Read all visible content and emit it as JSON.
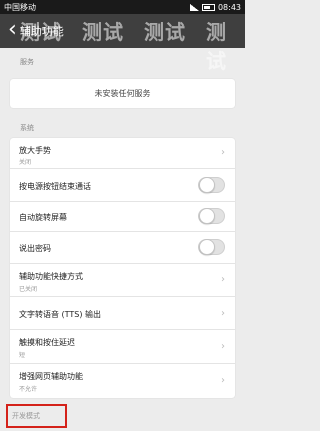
{
  "statusbar": {
    "carrier": "中国移动",
    "time": "08:43"
  },
  "titlebar": {
    "title": "辅助功能"
  },
  "watermark": [
    "测试",
    "测试",
    "测试",
    "测试",
    "测试"
  ],
  "services": {
    "section_label": "服务",
    "empty_text": "未安装任何服务"
  },
  "system": {
    "section_label": "系统",
    "items": [
      {
        "label": "放大手势",
        "sub": "关闭",
        "control": "chevron"
      },
      {
        "label": "按电源按钮结束通话",
        "control": "toggle"
      },
      {
        "label": "自动旋转屏幕",
        "control": "toggle"
      },
      {
        "label": "说出密码",
        "control": "toggle"
      },
      {
        "label": "辅助功能快捷方式",
        "sub": "已关闭",
        "control": "chevron"
      },
      {
        "label": "文字转语音 (TTS) 输出",
        "control": "chevron"
      },
      {
        "label": "触摸和按住延迟",
        "sub": "短",
        "control": "chevron"
      },
      {
        "label": "增强网页辅助功能",
        "sub": "不允许",
        "control": "chevron"
      }
    ]
  },
  "developer": {
    "section_label": "开发模式"
  }
}
